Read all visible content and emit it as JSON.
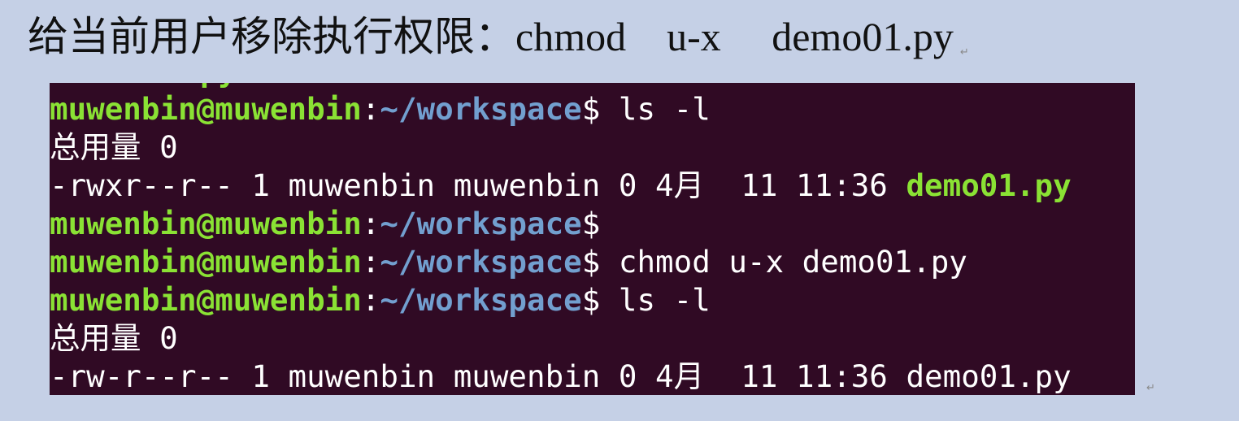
{
  "heading": {
    "chinese": "给当前用户移除执行权限：",
    "command": "chmod    u-x     demo01.py",
    "paragraph_mark": "↵"
  },
  "terminal": {
    "clipped_top": "py",
    "prompt_user": "muwenbin@muwenbin",
    "prompt_sep": ":",
    "prompt_path": "~/workspace",
    "prompt_dollar": "$",
    "lines": [
      {
        "type": "prompt",
        "command": " ls -l"
      },
      {
        "type": "output",
        "text": "总用量 0"
      },
      {
        "type": "listing",
        "meta": "-rwxr--r-- 1 muwenbin muwenbin 0 4月  11 11:36 ",
        "file": "demo01.py",
        "executable": true
      },
      {
        "type": "prompt",
        "command": ""
      },
      {
        "type": "prompt",
        "command": " chmod u-x demo01.py"
      },
      {
        "type": "prompt",
        "command": " ls -l"
      },
      {
        "type": "output",
        "text": "总用量 0"
      },
      {
        "type": "listing",
        "meta": "-rw-r--r-- 1 muwenbin muwenbin 0 4月  11 11:36 ",
        "file": "demo01.py",
        "executable": false
      }
    ]
  },
  "bottom_mark": "↵",
  "colors": {
    "page_background": "#c5d0e6",
    "terminal_background": "#300a24",
    "prompt_user": "#8ae234",
    "prompt_path": "#729fcf",
    "executable_file": "#8ae234",
    "text": "#ffffff"
  }
}
